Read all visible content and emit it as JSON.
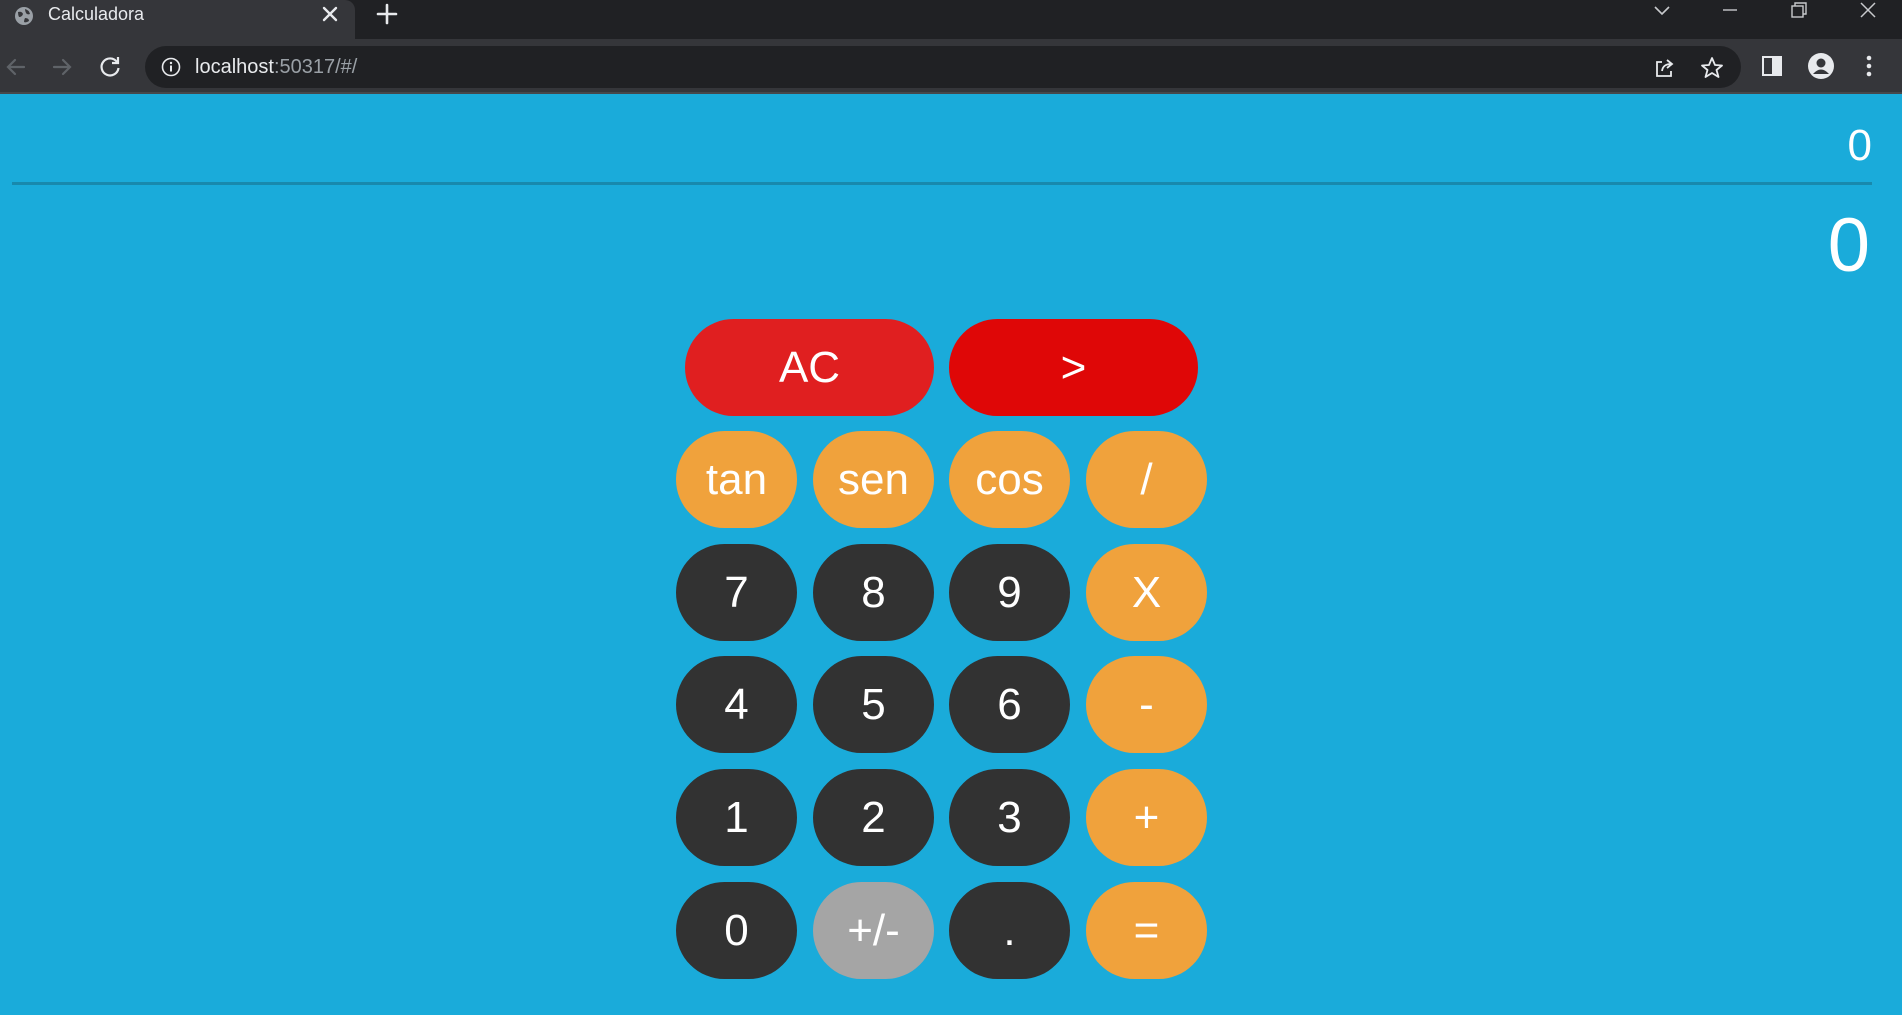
{
  "browser": {
    "tab_title": "Calculadora",
    "url_host": "localhost",
    "url_rest": ":50317/#/"
  },
  "display": {
    "expression": "0",
    "result": "0"
  },
  "keys": {
    "clear": "AC",
    "backspace": ">",
    "tan": "tan",
    "sen": "sen",
    "cos": "cos",
    "divide": "/",
    "seven": "7",
    "eight": "8",
    "nine": "9",
    "multiply": "X",
    "four": "4",
    "five": "5",
    "six": "6",
    "minus": "-",
    "one": "1",
    "two": "2",
    "three": "3",
    "plus": "+",
    "zero": "0",
    "sign": "+/-",
    "decimal": ".",
    "equals": "="
  },
  "colors": {
    "background": "#1aabda",
    "number_key": "#323232",
    "operator_key": "#f0a23c",
    "sign_key": "#a5a5a5",
    "clear_key": "#e01f20",
    "backspace_key": "#df0707"
  },
  "icons": {
    "tab_favicon": "globe-icon",
    "tab_close": "close-icon",
    "new_tab": "plus-icon",
    "back": "arrow-left-icon",
    "forward": "arrow-right-icon",
    "reload": "reload-icon",
    "site_info": "info-icon",
    "share": "share-icon",
    "bookmark": "star-icon",
    "side_panel": "side-panel-icon",
    "profile": "profile-icon",
    "menu": "kebab-menu-icon"
  }
}
